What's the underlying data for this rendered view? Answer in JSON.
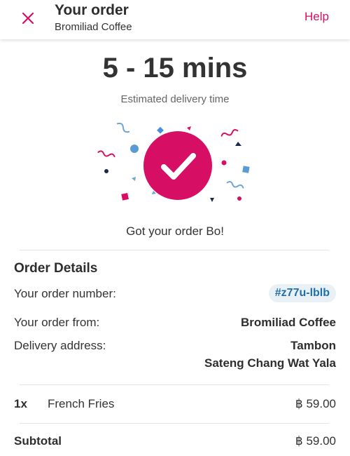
{
  "header": {
    "title": "Your order",
    "subtitle": "Bromiliad Coffee",
    "help_label": "Help",
    "close_icon": "close-icon",
    "accent_color": "#d70f64"
  },
  "delivery": {
    "time": "5 - 15 mins",
    "label": "Estimated delivery time",
    "confirmation": "Got your order Bo!"
  },
  "order_details": {
    "title": "Order Details",
    "order_number_label": "Your order number:",
    "order_number": "#z77u-lblb",
    "order_from_label": "Your order from:",
    "order_from": "Bromiliad Coffee",
    "address_label": "Delivery address:",
    "address_line1": "Tambon",
    "address_line2": "Sateng Chang Wat Yala"
  },
  "items": [
    {
      "qty": "1x",
      "name": "French Fries",
      "price": "฿ 59.00"
    }
  ],
  "subtotal": {
    "label": "Subtotal",
    "value": "฿ 59.00"
  }
}
